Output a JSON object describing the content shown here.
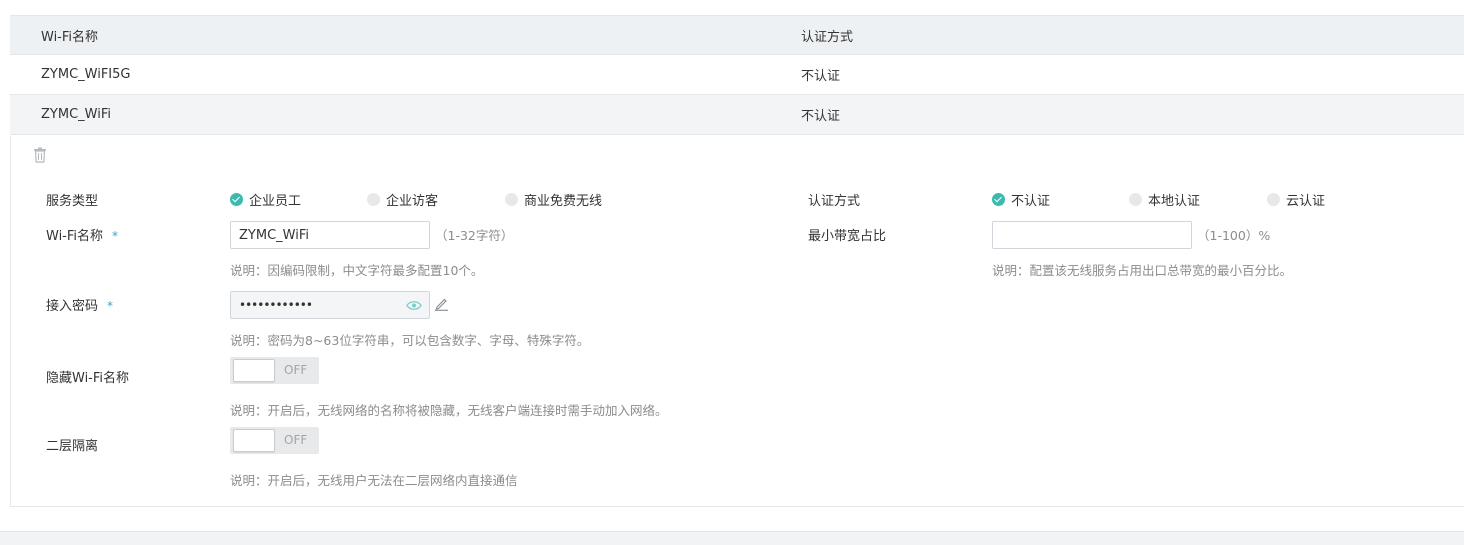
{
  "table": {
    "headers": {
      "name": "Wi-Fi名称",
      "auth": "认证方式"
    },
    "rows": [
      {
        "name": "ZYMC_WiFI5G",
        "auth": "不认证"
      },
      {
        "name": "ZYMC_WiFi",
        "auth": "不认证"
      }
    ]
  },
  "form": {
    "service_type": {
      "label": "服务类型",
      "options": [
        "企业员工",
        "企业访客",
        "商业免费无线"
      ],
      "selected": "企业员工"
    },
    "auth_method": {
      "label": "认证方式",
      "options": [
        "不认证",
        "本地认证",
        "云认证"
      ],
      "selected": "不认证"
    },
    "ssid": {
      "label": "Wi-Fi名称",
      "required_mark": "*",
      "value": "ZYMC_WiFi",
      "range": "（1-32字符）",
      "hint": "说明：因编码限制，中文字符最多配置10个。"
    },
    "min_bandwidth": {
      "label": "最小带宽占比",
      "value": "",
      "range": "（1-100）%",
      "hint": "说明：配置该无线服务占用出口总带宽的最小百分比。"
    },
    "password": {
      "label": "接入密码",
      "required_mark": "*",
      "value": "••••••••••••",
      "hint": "说明：密码为8~63位字符串，可以包含数字、字母、特殊字符。"
    },
    "hide_ssid": {
      "label": "隐藏Wi-Fi名称",
      "state": "OFF",
      "hint": "说明：开启后，无线网络的名称将被隐藏，无线客户端连接时需手动加入网络。"
    },
    "isolation": {
      "label": "二层隔离",
      "state": "OFF",
      "hint": "说明：开启后，无线用户无法在二层网络内直接通信"
    }
  },
  "colors": {
    "accent": "#3dbab0",
    "required": "#3fa3c6",
    "header_bg": "#eef1f3"
  }
}
